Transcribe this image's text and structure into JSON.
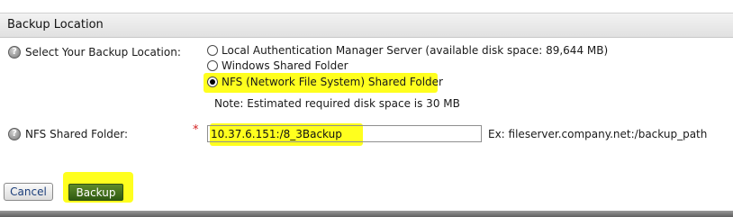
{
  "section": {
    "title": "Backup Location"
  },
  "backup_location": {
    "help_glyph": "?",
    "label": "Select Your Backup Location:",
    "options": [
      {
        "label": "Local Authentication Manager Server (available disk space: 89,644 MB)",
        "selected": false
      },
      {
        "label": "Windows Shared Folder",
        "selected": false
      },
      {
        "label": "NFS (Network File System) Shared Folder",
        "selected": true
      }
    ],
    "note": "Note: Estimated required disk space is 30 MB"
  },
  "nfs_folder": {
    "help_glyph": "?",
    "label": "NFS Shared Folder:",
    "required_mark": "*",
    "value": "10.37.6.151:/8_3Backup",
    "example": "Ex: fileserver.company.net:/backup_path"
  },
  "actions": {
    "cancel_label": "Cancel",
    "backup_label": "Backup"
  },
  "colors": {
    "highlight": "#ffff1e",
    "backup_button": "#3f6b1a",
    "required": "#d42020"
  },
  "icons": {
    "help": "help-circle-icon",
    "radio": "radio-button-icon"
  }
}
